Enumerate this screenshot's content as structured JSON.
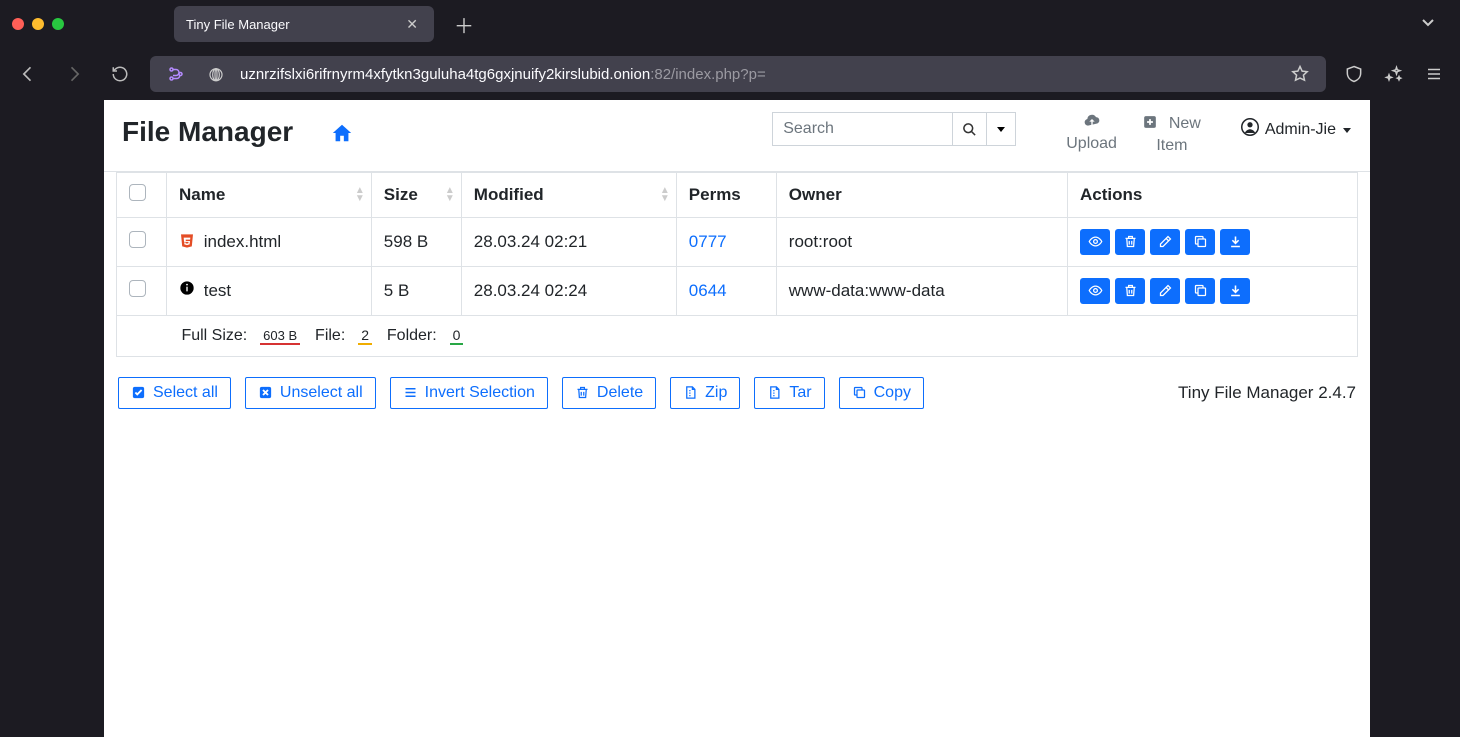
{
  "browser": {
    "tab_title": "Tiny File Manager",
    "url_host": "uznrzifslxi6rifrnyrm4xfytkn3guluha4tg6gxjnuify2kirslubid.onion",
    "url_path": ":82/index.php?p="
  },
  "header": {
    "brand": "File Manager",
    "search_placeholder": "Search",
    "upload_label": "Upload",
    "new_item_label": "New Item",
    "user_label": "Admin-Jie"
  },
  "table": {
    "columns": {
      "name": "Name",
      "size": "Size",
      "modified": "Modified",
      "perms": "Perms",
      "owner": "Owner",
      "actions": "Actions"
    },
    "rows": [
      {
        "icon": "html5",
        "name": "index.html",
        "size": "598 B",
        "modified": "28.03.24 02:21",
        "perms": "0777",
        "owner": "root:root"
      },
      {
        "icon": "info",
        "name": "test",
        "size": "5 B",
        "modified": "28.03.24 02:24",
        "perms": "0644",
        "owner": "www-data:www-data"
      }
    ],
    "summary": {
      "full_size_label": "Full Size:",
      "full_size": "603 B",
      "file_label": "File:",
      "file_count": "2",
      "folder_label": "Folder:",
      "folder_count": "0"
    }
  },
  "footer": {
    "select_all": "Select all",
    "unselect_all": "Unselect all",
    "invert": "Invert Selection",
    "delete": "Delete",
    "zip": "Zip",
    "tar": "Tar",
    "copy": "Copy",
    "version": "Tiny File Manager 2.4.7"
  }
}
